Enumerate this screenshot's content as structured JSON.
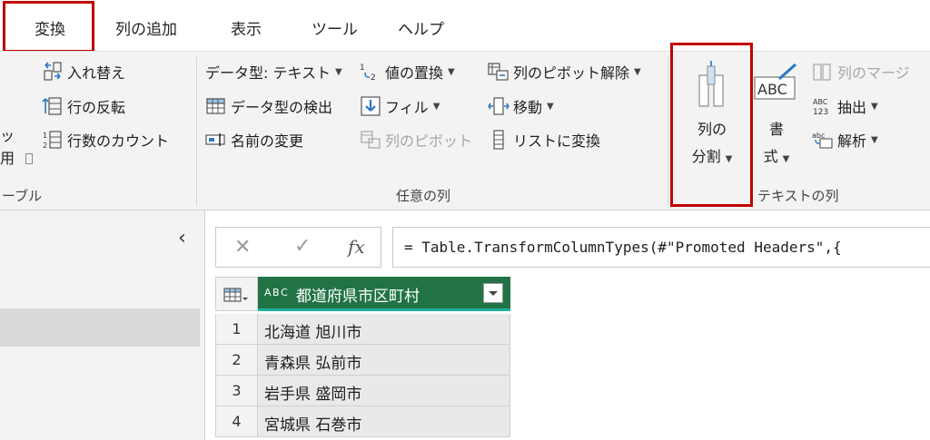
{
  "tabs": {
    "transform": "変換",
    "add_column": "列の追加",
    "view": "表示",
    "tools": "ツール",
    "help": "ヘルプ"
  },
  "ribbon": {
    "left_partial": {
      "line1": "ッ",
      "line2": "用",
      "group": "ーブル"
    },
    "table_group": {
      "swap": "入れ替え",
      "reverse_rows": "行の反転",
      "count_rows": "行数のカウント"
    },
    "any_column": {
      "data_type": "データ型: テキスト",
      "detect_type": "データ型の検出",
      "rename": "名前の変更",
      "replace_values": "値の置換",
      "fill": "フィル",
      "pivot": "列のピボット",
      "unpivot": "列のピボット解除",
      "move": "移動",
      "to_list": "リストに変換",
      "group_label": "任意の列"
    },
    "text_column": {
      "split_line1": "列の",
      "split_line2": "分割",
      "format_line1": "書",
      "format_line2": "式",
      "merge": "列のマージ",
      "extract": "抽出",
      "parse": "解析",
      "group_label": "テキストの列"
    }
  },
  "formula_bar": {
    "cancel_symbol": "✕",
    "confirm_symbol": "✓",
    "fx_symbol": "fx",
    "formula": "= Table.TransformColumnTypes(#\"Promoted Headers\",{"
  },
  "grid": {
    "column_type": "A B C",
    "column_header": "都道府県市区町村",
    "rows": [
      {
        "n": "1",
        "value": "北海道 旭川市"
      },
      {
        "n": "2",
        "value": "青森県 弘前市"
      },
      {
        "n": "3",
        "value": "岩手県 盛岡市"
      },
      {
        "n": "4",
        "value": "宮城県 石巻市"
      }
    ]
  },
  "colors": {
    "highlight": "#c00000",
    "header_green": "#217346",
    "ribbon_bg": "#f3f3f3"
  }
}
